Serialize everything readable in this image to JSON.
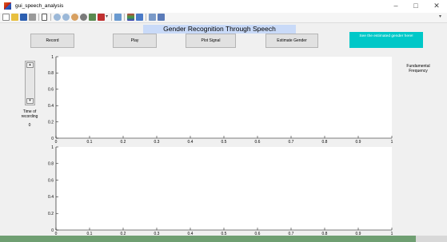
{
  "window": {
    "title": "gui_speech_analysis",
    "controls": {
      "minimize": "–",
      "maximize": "□",
      "close": "✕"
    }
  },
  "toolbar": {
    "icons": [
      "new-figure-icon",
      "open-file-icon",
      "save-icon",
      "print-icon",
      "pointer-icon",
      "zoom-in-icon",
      "zoom-out-icon",
      "pan-icon",
      "rotate-icon",
      "data-cursor-icon",
      "brush-icon",
      "link-plot-icon",
      "colorbar-icon",
      "legend-icon",
      "hide-plot-tools-icon",
      "show-plot-tools-icon"
    ],
    "overflow": "▾"
  },
  "heading": "Gender Recognition Through Speech",
  "buttons": {
    "record": "Record",
    "play": "Play",
    "plot_signal": "Plot Signal",
    "estimate_gender": "Estimate Gender",
    "result": "See the estimated gender here!"
  },
  "recording": {
    "label": "Time of recording",
    "value": "0",
    "slider_level": 0
  },
  "fundamental_frequency_label": "Fundamental Frequency",
  "colors": {
    "heading_bg": "#c9daf8",
    "result_bg": "#00c8c8",
    "figure_bg": "#f0f0f0",
    "axes_bg": "#ffffff"
  },
  "chart_data": [
    {
      "type": "line",
      "series": [],
      "xlim": [
        0,
        1
      ],
      "ylim": [
        0,
        1
      ],
      "x_ticks": [
        "0",
        "0.1",
        "0.2",
        "0.3",
        "0.4",
        "0.5",
        "0.6",
        "0.7",
        "0.8",
        "0.9",
        "1"
      ],
      "y_ticks": [
        "0",
        "0.2",
        "0.4",
        "0.6",
        "0.8",
        "1"
      ],
      "grid": false
    },
    {
      "type": "line",
      "series": [],
      "xlim": [
        0,
        1
      ],
      "ylim": [
        0,
        1
      ],
      "x_ticks": [
        "0",
        "0.1",
        "0.2",
        "0.3",
        "0.4",
        "0.5",
        "0.6",
        "0.7",
        "0.8",
        "0.9",
        "1"
      ],
      "y_ticks": [
        "0",
        "0.2",
        "0.4",
        "0.6",
        "0.8",
        "1"
      ],
      "grid": false
    }
  ]
}
